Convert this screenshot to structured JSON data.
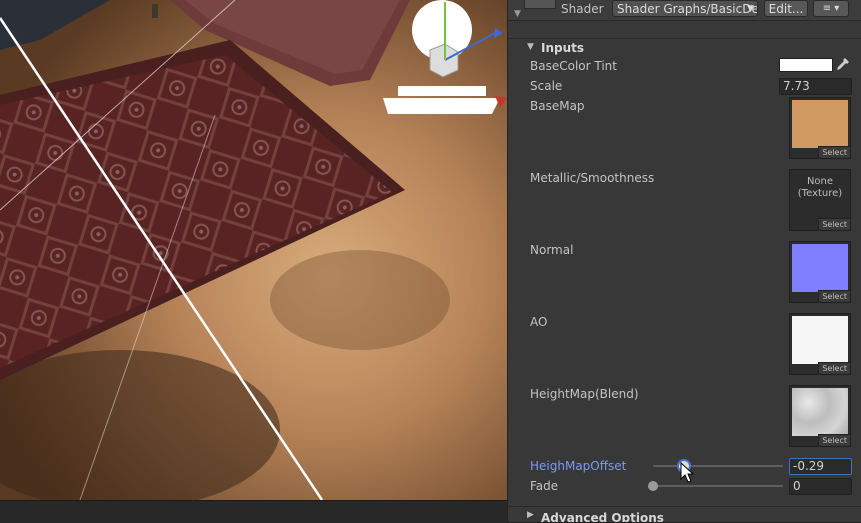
{
  "inspector": {
    "shader_label": "Shader",
    "shader_value": "Shader Graphs/BasicDe",
    "edit_label": "Edit...",
    "list_icon": "≡ ▾",
    "inputs_title": "Inputs",
    "advanced_title": "Advanced Options",
    "properties": {
      "basecolor_tint": {
        "label": "BaseColor Tint",
        "color": "#ffffff"
      },
      "scale": {
        "label": "Scale",
        "value": "7.73"
      },
      "basemap": {
        "label": "BaseMap",
        "select": "Select",
        "preview_color": "#d19a63"
      },
      "metallic": {
        "label": "Metallic/Smoothness",
        "none_line1": "None",
        "none_line2": "(Texture)",
        "select": "Select"
      },
      "normal": {
        "label": "Normal",
        "select": "Select",
        "preview_color": "#7f7fff"
      },
      "ao": {
        "label": "AO",
        "select": "Select",
        "preview_color": "#f6f6f6"
      },
      "heightmap": {
        "label": "HeightMap(Blend)",
        "select": "Select",
        "preview_color": "#cfcfcf"
      },
      "heightmap_offset": {
        "label": "HeighMapOffset",
        "value": "-0.29",
        "slider_fraction": 0.24
      },
      "fade": {
        "label": "Fade",
        "value": "0",
        "slider_fraction": 0.0
      }
    }
  }
}
